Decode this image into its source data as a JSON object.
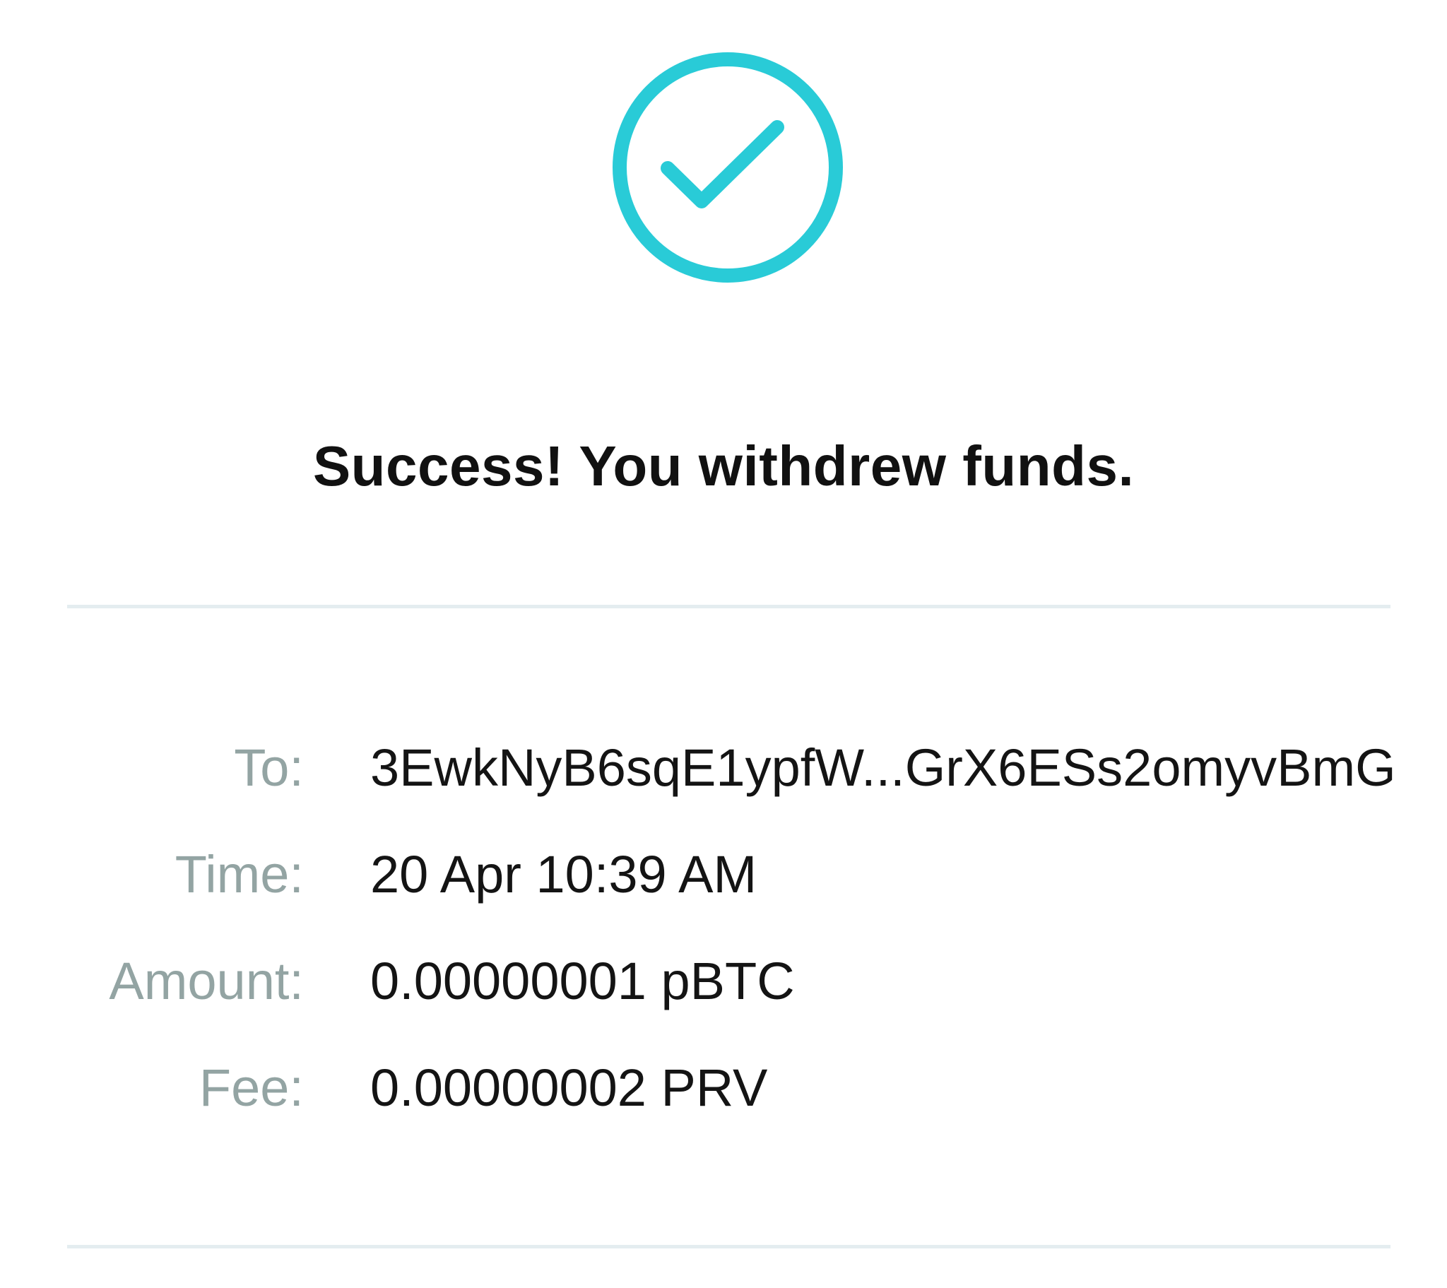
{
  "status": {
    "icon": "check-circle-icon",
    "accent_color": "#29cbd7",
    "title": "Success! You withdrew funds."
  },
  "details": {
    "to": {
      "label": "To:",
      "value": "3EwkNyB6sqE1ypfW...GrX6ESs2omyvBmG"
    },
    "time": {
      "label": "Time:",
      "value": "20 Apr 10:39 AM"
    },
    "amount": {
      "label": "Amount:",
      "value": "0.00000001 pBTC"
    },
    "fee": {
      "label": "Fee:",
      "value": "0.00000002 PRV"
    }
  },
  "colors": {
    "label": "#93a4a3",
    "value": "#141414",
    "divider": "#e4edf0"
  }
}
